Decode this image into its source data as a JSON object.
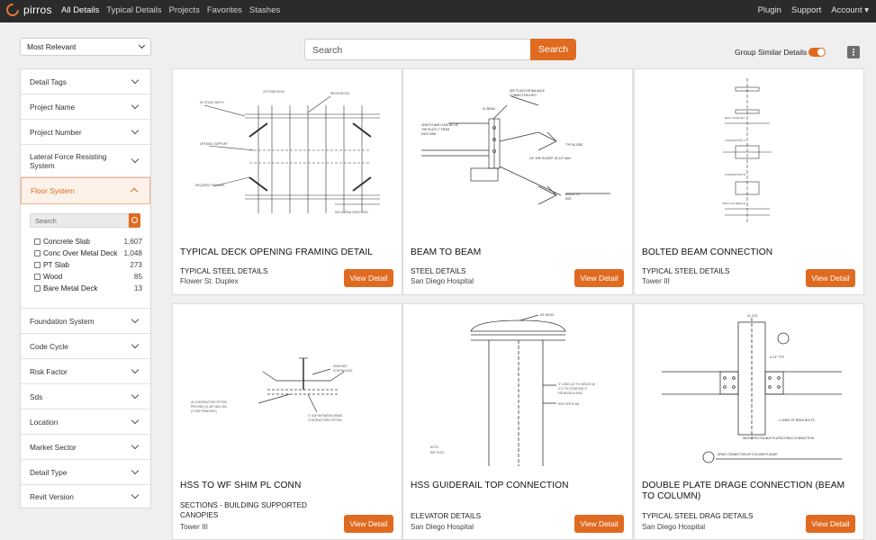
{
  "brand": {
    "name": "pirros",
    "accent": "#e06a20"
  },
  "nav": {
    "links": [
      "All Details",
      "Typical Details",
      "Projects",
      "Favorites",
      "Stashes"
    ],
    "right": [
      "Plugin",
      "Support",
      "Account ▾"
    ]
  },
  "sort": {
    "selected": "Most Relevant"
  },
  "search": {
    "placeholder": "Search",
    "button": "Search"
  },
  "group_similar": {
    "label": "Group Similar Details",
    "on": true
  },
  "filters": {
    "items": [
      "Detail Tags",
      "Project Name",
      "Project Number",
      "Lateral Force Resisting System",
      "Floor System",
      "Foundation System",
      "Code Cycle",
      "Risk Factor",
      "Sds",
      "Location",
      "Market Sector",
      "Detail Type",
      "Revit Version"
    ],
    "floor_system": {
      "search_placeholder": "Search",
      "options": [
        {
          "label": "Concrete Slab",
          "count": "1,607"
        },
        {
          "label": "Conc Over Metal Deck",
          "count": "1,048"
        },
        {
          "label": "PT Slab",
          "count": "273"
        },
        {
          "label": "Wood",
          "count": "85"
        },
        {
          "label": "Bare Metal Deck",
          "count": "13"
        }
      ]
    }
  },
  "cards": [
    {
      "title": "TYPICAL DECK OPENING FRAMING DETAIL",
      "category": "TYPICAL STEEL DETAILS",
      "project": "Flower St. Duplex",
      "button": "View Detail"
    },
    {
      "title": "BEAM TO BEAM",
      "category": "STEEL DETAILS",
      "project": "San Diego Hospital",
      "button": "View Detail"
    },
    {
      "title": "BOLTED BEAM CONNECTION",
      "category": "TYPICAL STEEL DETAILS",
      "project": "Tower III",
      "button": "View Detail"
    },
    {
      "title": "HSS TO WF SHIM PL CONN",
      "category": "SECTIONS - BUILDING SUPPORTED CANOPIES",
      "project": "Tower III",
      "button": "View Detail"
    },
    {
      "title": "HSS GUIDERAIL TOP CONNECTION",
      "category": "ELEVATOR DETAILS",
      "project": "San Diego Hospital",
      "button": "View Detail"
    },
    {
      "title": "DOUBLE PLATE DRAGE CONNECTION (BEAM TO COLUMN)",
      "category": "TYPICAL STEEL DRAG DETAILS",
      "project": "San Diego Hospital",
      "button": "View Detail"
    }
  ]
}
